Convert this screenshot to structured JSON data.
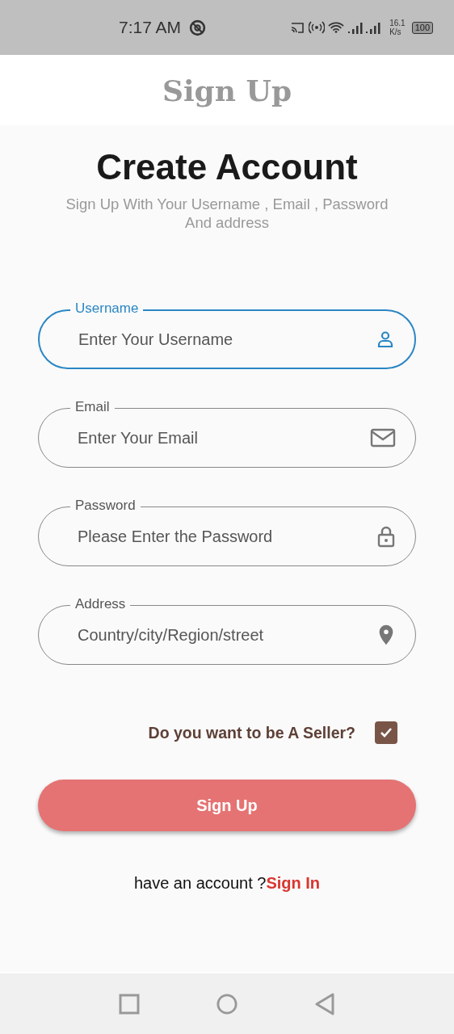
{
  "status_bar": {
    "time": "7:17 AM",
    "speed": "16.1",
    "speed_unit": "K/s",
    "battery": "100"
  },
  "app_bar": {
    "title": "Sign Up"
  },
  "heading": "Create Account",
  "subtitle": "Sign Up With Your Username , Email , Password And address",
  "fields": [
    {
      "label": "Username",
      "placeholder": "Enter Your Username",
      "kind": "user",
      "focused": true
    },
    {
      "label": "Email",
      "placeholder": "Enter Your Email",
      "kind": "email",
      "focused": false
    },
    {
      "label": "Password",
      "placeholder": "Please Enter the Password",
      "kind": "password",
      "focused": false
    },
    {
      "label": "Address",
      "placeholder": "Country/city/Region/street",
      "kind": "address",
      "focused": false
    }
  ],
  "seller": {
    "label": "Do you want to be A Seller?",
    "checked": true
  },
  "submit": "Sign Up",
  "footer": {
    "text": "have an account ?",
    "link": "Sign In"
  }
}
